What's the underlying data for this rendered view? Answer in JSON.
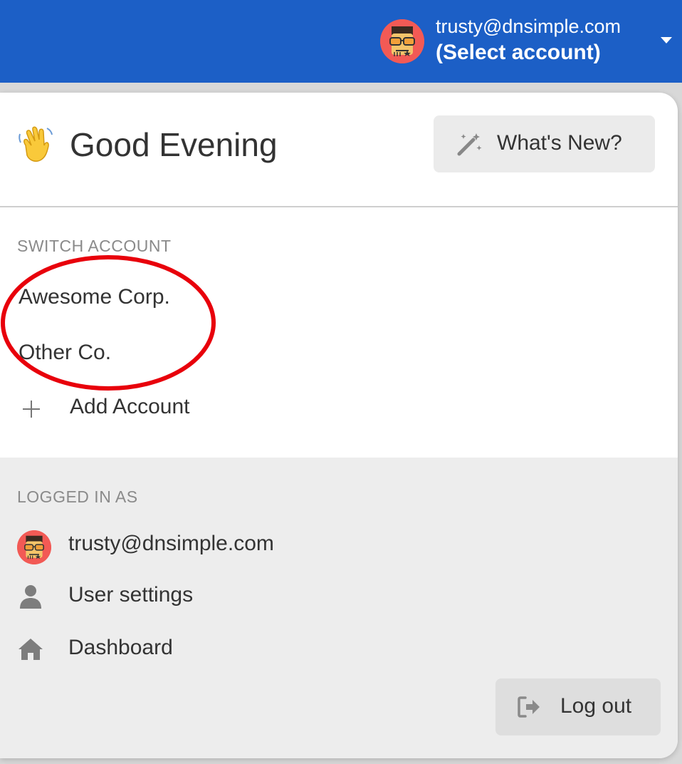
{
  "header": {
    "user_email": "trusty@dnsimple.com",
    "select_account_label": "(Select account)",
    "background_color": "#1c5fc6"
  },
  "greeting": {
    "emoji": "waving-hand",
    "text": "Good Evening",
    "whats_new_label": "What's New?"
  },
  "switch_account": {
    "section_label": "SWITCH ACCOUNT",
    "accounts": [
      {
        "label": "Awesome Corp."
      },
      {
        "label": "Other Co."
      }
    ],
    "add_account_label": "Add Account"
  },
  "logged_in": {
    "section_label": "LOGGED IN AS",
    "email": "trusty@dnsimple.com",
    "items": [
      {
        "label": "User settings",
        "icon": "user-icon"
      },
      {
        "label": "Dashboard",
        "icon": "home-icon"
      }
    ],
    "logout_label": "Log out"
  },
  "annotation": {
    "shape": "ellipse",
    "color": "#e8000b"
  }
}
